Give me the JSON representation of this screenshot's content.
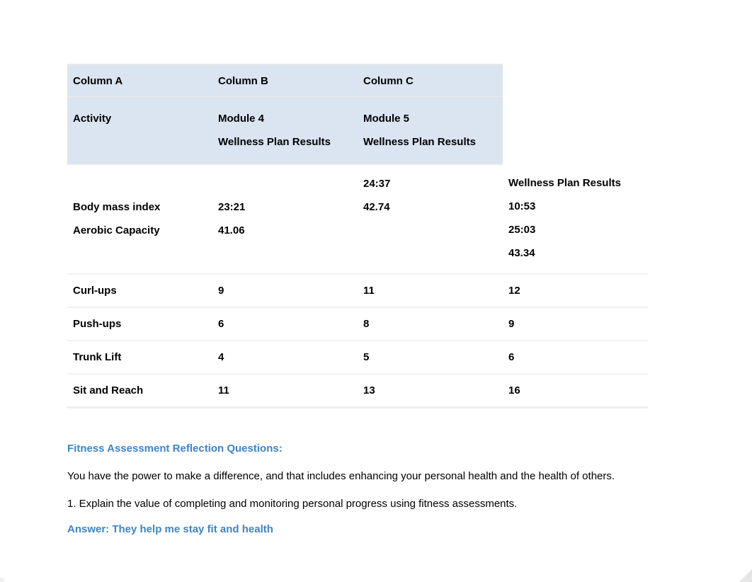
{
  "table": {
    "header1": {
      "colA": "Column A",
      "colB": "Column B",
      "colC": "Column C"
    },
    "header2": {
      "activity": "Activity",
      "module4": "Module 4\nWellness Plan Results",
      "module5": "Module 5\nWellness Plan Results"
    },
    "row_bmi_aerobic": {
      "labels": "\nBody mass index\nAerobic Capacity",
      "colB": "\n23:21\n41.06",
      "colC": "24:37\n42.74",
      "colD": "Wellness Plan Results\n10:53\n25:03\n 43.34"
    },
    "rows": [
      {
        "label": "Curl-ups",
        "b": "9",
        "c": "11",
        "d": "12"
      },
      {
        "label": "Push-ups",
        "b": "6",
        "c": "8",
        "d": "9"
      },
      {
        "label": "Trunk Lift",
        "b": "4",
        "c": "5",
        "d": "6"
      },
      {
        "label": "Sit and Reach",
        "b": "11",
        "c": "13",
        "d": "16"
      }
    ]
  },
  "reflection": {
    "heading": "Fitness Assessment Reflection Questions:",
    "intro": "You have the power to make a difference, and that includes enhancing your personal health and the health of others.",
    "q1": "1. Explain the value of completing and monitoring personal progress using fitness assessments.",
    "answer1": "Answer: They help me stay fit and health"
  }
}
